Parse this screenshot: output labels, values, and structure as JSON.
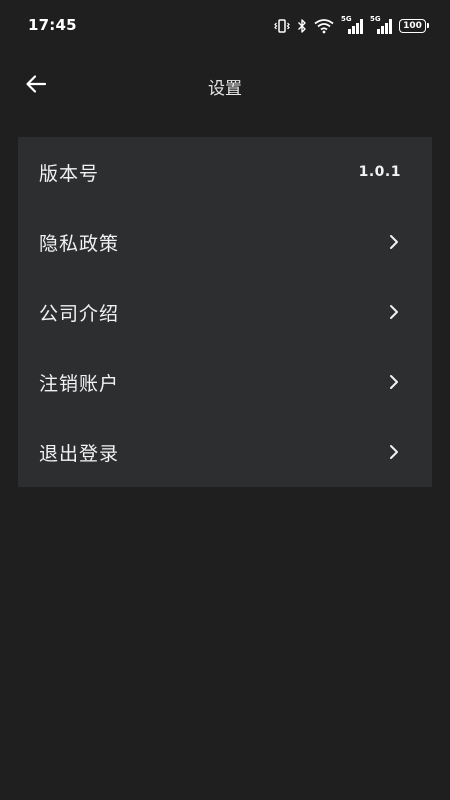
{
  "status_bar": {
    "time": "17:45",
    "network_1": "5G",
    "network_2": "5G",
    "battery": "100",
    "icons": [
      "vibrate-icon",
      "bluetooth-icon",
      "wifi-icon",
      "signal-5g-icon",
      "signal-5g-icon",
      "battery-icon"
    ]
  },
  "header": {
    "title": "设置",
    "back_icon": "arrow-left-icon"
  },
  "settings": {
    "items": [
      {
        "label": "版本号",
        "value": "1.0.1"
      },
      {
        "label": "隐私政策",
        "icon": "chevron-right-icon"
      },
      {
        "label": "公司介绍",
        "icon": "chevron-right-icon"
      },
      {
        "label": "注销账户",
        "icon": "chevron-right-icon"
      },
      {
        "label": "退出登录",
        "icon": "chevron-right-icon"
      }
    ]
  },
  "colors": {
    "background": "#1f1f1f",
    "card": "#2d2e30",
    "text": "#f2f2f2"
  }
}
